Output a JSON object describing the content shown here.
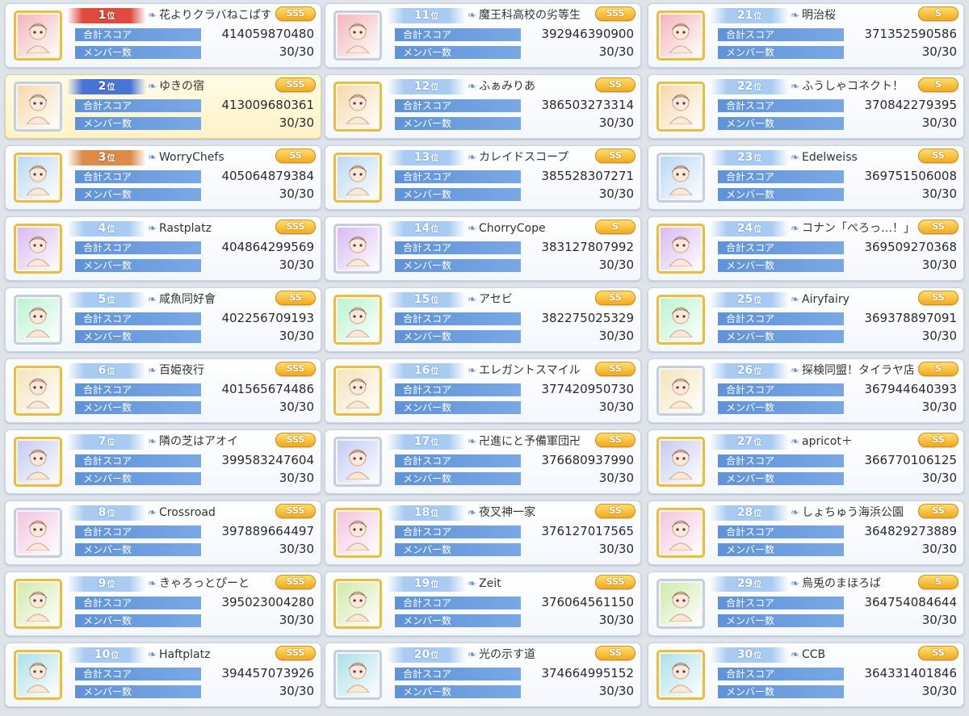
{
  "labels": {
    "score": "合計スコア",
    "members": "メンバー数"
  },
  "rank_suffix": "位",
  "clans": [
    {
      "rank": "1",
      "name": "花よりクラバねこぱす",
      "tier": "SSS",
      "score": "414059870480",
      "members": "30/30"
    },
    {
      "rank": "2",
      "name": "ゆきの宿",
      "tier": "SSS",
      "score": "413009680361",
      "members": "30/30"
    },
    {
      "rank": "3",
      "name": "WorryChefs",
      "tier": "SS",
      "score": "405064879384",
      "members": "30/30"
    },
    {
      "rank": "4",
      "name": "Rastplatz",
      "tier": "SSS",
      "score": "404864299569",
      "members": "30/30"
    },
    {
      "rank": "5",
      "name": "咸魚同好會",
      "tier": "SS",
      "score": "402256709193",
      "members": "30/30"
    },
    {
      "rank": "6",
      "name": "百姫夜行",
      "tier": "SSS",
      "score": "401565674486",
      "members": "30/30"
    },
    {
      "rank": "7",
      "name": "隣の芝はアオイ",
      "tier": "SSS",
      "score": "399583247604",
      "members": "30/30"
    },
    {
      "rank": "8",
      "name": "Crossroad",
      "tier": "SSS",
      "score": "397889664497",
      "members": "30/30"
    },
    {
      "rank": "9",
      "name": "きゃろっとぴーと",
      "tier": "SSS",
      "score": "395023004280",
      "members": "30/30"
    },
    {
      "rank": "10",
      "name": "Haftplatz",
      "tier": "SSS",
      "score": "394457073926",
      "members": "30/30"
    },
    {
      "rank": "11",
      "name": "魔王科高校の劣等生",
      "tier": "SSS",
      "score": "392946390900",
      "members": "30/30"
    },
    {
      "rank": "12",
      "name": "ふぁみりあ",
      "tier": "SS",
      "score": "386503273314",
      "members": "30/30"
    },
    {
      "rank": "13",
      "name": "カレイドスコープ",
      "tier": "SS",
      "score": "385528307271",
      "members": "30/30"
    },
    {
      "rank": "14",
      "name": "ChorryCope",
      "tier": "S",
      "score": "383127807992",
      "members": "30/30"
    },
    {
      "rank": "15",
      "name": "アセビ",
      "tier": "SS",
      "score": "382275025329",
      "members": "30/30"
    },
    {
      "rank": "16",
      "name": "エレガントスマイル",
      "tier": "SS",
      "score": "377420950730",
      "members": "30/30"
    },
    {
      "rank": "17",
      "name": "卍進にと予備軍団卍",
      "tier": "SS",
      "score": "376680937990",
      "members": "30/30"
    },
    {
      "rank": "18",
      "name": "夜叉神一家",
      "tier": "SS",
      "score": "376127017565",
      "members": "30/30"
    },
    {
      "rank": "19",
      "name": "Zeit",
      "tier": "SSS",
      "score": "376064561150",
      "members": "30/30"
    },
    {
      "rank": "20",
      "name": "光の示す道",
      "tier": "SS",
      "score": "374664995152",
      "members": "30/30"
    },
    {
      "rank": "21",
      "name": "明治桜",
      "tier": "S",
      "score": "371352590586",
      "members": "30/30"
    },
    {
      "rank": "22",
      "name": "ふうしゃコネクト！",
      "tier": "S",
      "score": "370842279395",
      "members": "30/30"
    },
    {
      "rank": "23",
      "name": "Edelweiss",
      "tier": "SS",
      "score": "369751506008",
      "members": "30/30"
    },
    {
      "rank": "24",
      "name": "コナン「ぺろっ…！」",
      "tier": "SS",
      "score": "369509270368",
      "members": "30/30"
    },
    {
      "rank": "25",
      "name": "Airyfairy",
      "tier": "SS",
      "score": "369378897091",
      "members": "30/30"
    },
    {
      "rank": "26",
      "name": "探検同盟！タイラヤ店",
      "tier": "S",
      "score": "367944640393",
      "members": "30/30"
    },
    {
      "rank": "27",
      "name": "apricot＋",
      "tier": "SS",
      "score": "366770106125",
      "members": "30/30"
    },
    {
      "rank": "28",
      "name": "しょちゅう海浜公園",
      "tier": "SS",
      "score": "364829273889",
      "members": "30/30"
    },
    {
      "rank": "29",
      "name": "烏兎のまほろば",
      "tier": "S",
      "score": "364754084644",
      "members": "30/30"
    },
    {
      "rank": "30",
      "name": "CCB",
      "tier": "SS",
      "score": "364331401846",
      "members": "30/30"
    }
  ],
  "colors": {
    "label_bg": "#5f92d8",
    "badge_gold": "#f0a71a",
    "highlight": "#fff3c7"
  }
}
